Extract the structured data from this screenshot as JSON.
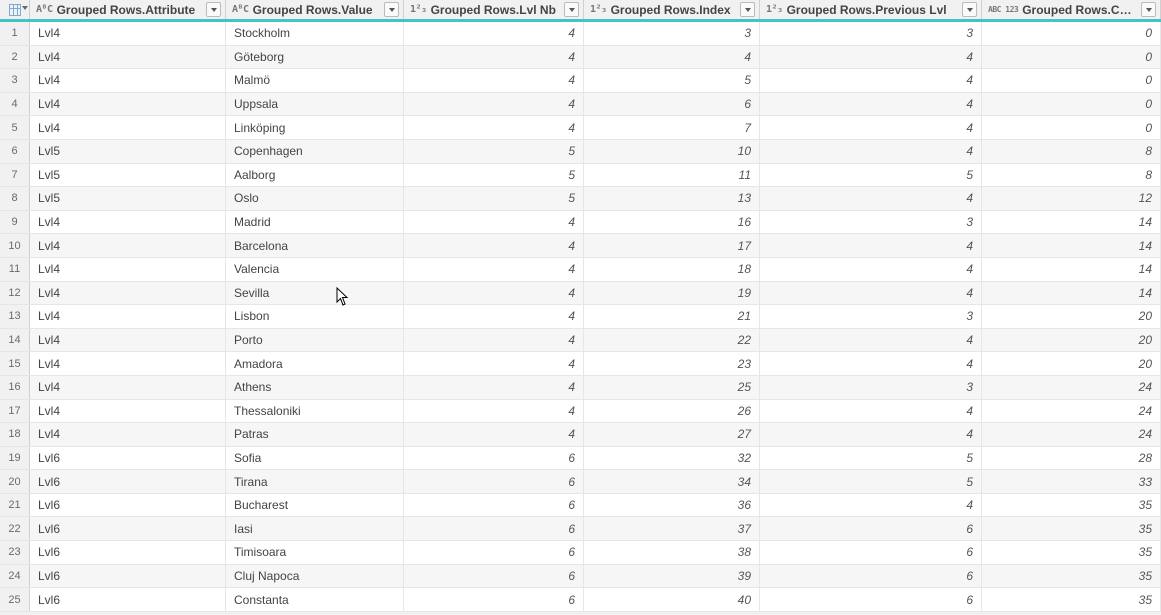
{
  "columns": [
    {
      "type_icon": "AᴮC",
      "label": "Grouped Rows.Attribute",
      "kind": "text"
    },
    {
      "type_icon": "AᴮC",
      "label": "Grouped Rows.Value",
      "kind": "text"
    },
    {
      "type_icon": "1²₃",
      "label": "Grouped Rows.Lvl Nb",
      "kind": "num"
    },
    {
      "type_icon": "1²₃",
      "label": "Grouped Rows.Index",
      "kind": "num"
    },
    {
      "type_icon": "1²₃",
      "label": "Grouped Rows.Previous Lvl",
      "kind": "num"
    },
    {
      "type_icon": "ABC 123",
      "label": "Grouped Rows.Custom",
      "kind": "num"
    }
  ],
  "rows": [
    {
      "n": "1",
      "attr": "Lvl4",
      "value": "Stockholm",
      "lvl": "4",
      "idx": "3",
      "prev": "3",
      "custom": "0"
    },
    {
      "n": "2",
      "attr": "Lvl4",
      "value": "Göteborg",
      "lvl": "4",
      "idx": "4",
      "prev": "4",
      "custom": "0"
    },
    {
      "n": "3",
      "attr": "Lvl4",
      "value": "Malmö",
      "lvl": "4",
      "idx": "5",
      "prev": "4",
      "custom": "0"
    },
    {
      "n": "4",
      "attr": "Lvl4",
      "value": "Uppsala",
      "lvl": "4",
      "idx": "6",
      "prev": "4",
      "custom": "0"
    },
    {
      "n": "5",
      "attr": "Lvl4",
      "value": "Linköping",
      "lvl": "4",
      "idx": "7",
      "prev": "4",
      "custom": "0"
    },
    {
      "n": "6",
      "attr": "Lvl5",
      "value": "Copenhagen",
      "lvl": "5",
      "idx": "10",
      "prev": "4",
      "custom": "8"
    },
    {
      "n": "7",
      "attr": "Lvl5",
      "value": "Aalborg",
      "lvl": "5",
      "idx": "11",
      "prev": "5",
      "custom": "8"
    },
    {
      "n": "8",
      "attr": "Lvl5",
      "value": "Oslo",
      "lvl": "5",
      "idx": "13",
      "prev": "4",
      "custom": "12"
    },
    {
      "n": "9",
      "attr": "Lvl4",
      "value": "Madrid",
      "lvl": "4",
      "idx": "16",
      "prev": "3",
      "custom": "14"
    },
    {
      "n": "10",
      "attr": "Lvl4",
      "value": "Barcelona",
      "lvl": "4",
      "idx": "17",
      "prev": "4",
      "custom": "14"
    },
    {
      "n": "11",
      "attr": "Lvl4",
      "value": "Valencia",
      "lvl": "4",
      "idx": "18",
      "prev": "4",
      "custom": "14"
    },
    {
      "n": "12",
      "attr": "Lvl4",
      "value": "Sevilla",
      "lvl": "4",
      "idx": "19",
      "prev": "4",
      "custom": "14"
    },
    {
      "n": "13",
      "attr": "Lvl4",
      "value": "Lisbon",
      "lvl": "4",
      "idx": "21",
      "prev": "3",
      "custom": "20"
    },
    {
      "n": "14",
      "attr": "Lvl4",
      "value": "Porto",
      "lvl": "4",
      "idx": "22",
      "prev": "4",
      "custom": "20"
    },
    {
      "n": "15",
      "attr": "Lvl4",
      "value": "Amadora",
      "lvl": "4",
      "idx": "23",
      "prev": "4",
      "custom": "20"
    },
    {
      "n": "16",
      "attr": "Lvl4",
      "value": "Athens",
      "lvl": "4",
      "idx": "25",
      "prev": "3",
      "custom": "24"
    },
    {
      "n": "17",
      "attr": "Lvl4",
      "value": "Thessaloniki",
      "lvl": "4",
      "idx": "26",
      "prev": "4",
      "custom": "24"
    },
    {
      "n": "18",
      "attr": "Lvl4",
      "value": "Patras",
      "lvl": "4",
      "idx": "27",
      "prev": "4",
      "custom": "24"
    },
    {
      "n": "19",
      "attr": "Lvl6",
      "value": "Sofia",
      "lvl": "6",
      "idx": "32",
      "prev": "5",
      "custom": "28"
    },
    {
      "n": "20",
      "attr": "Lvl6",
      "value": "Tirana",
      "lvl": "6",
      "idx": "34",
      "prev": "5",
      "custom": "33"
    },
    {
      "n": "21",
      "attr": "Lvl6",
      "value": "Bucharest",
      "lvl": "6",
      "idx": "36",
      "prev": "4",
      "custom": "35"
    },
    {
      "n": "22",
      "attr": "Lvl6",
      "value": "Iasi",
      "lvl": "6",
      "idx": "37",
      "prev": "6",
      "custom": "35"
    },
    {
      "n": "23",
      "attr": "Lvl6",
      "value": "Timisoara",
      "lvl": "6",
      "idx": "38",
      "prev": "6",
      "custom": "35"
    },
    {
      "n": "24",
      "attr": "Lvl6",
      "value": "Cluj Napoca",
      "lvl": "6",
      "idx": "39",
      "prev": "6",
      "custom": "35"
    },
    {
      "n": "25",
      "attr": "Lvl6",
      "value": "Constanta",
      "lvl": "6",
      "idx": "40",
      "prev": "6",
      "custom": "35"
    }
  ]
}
